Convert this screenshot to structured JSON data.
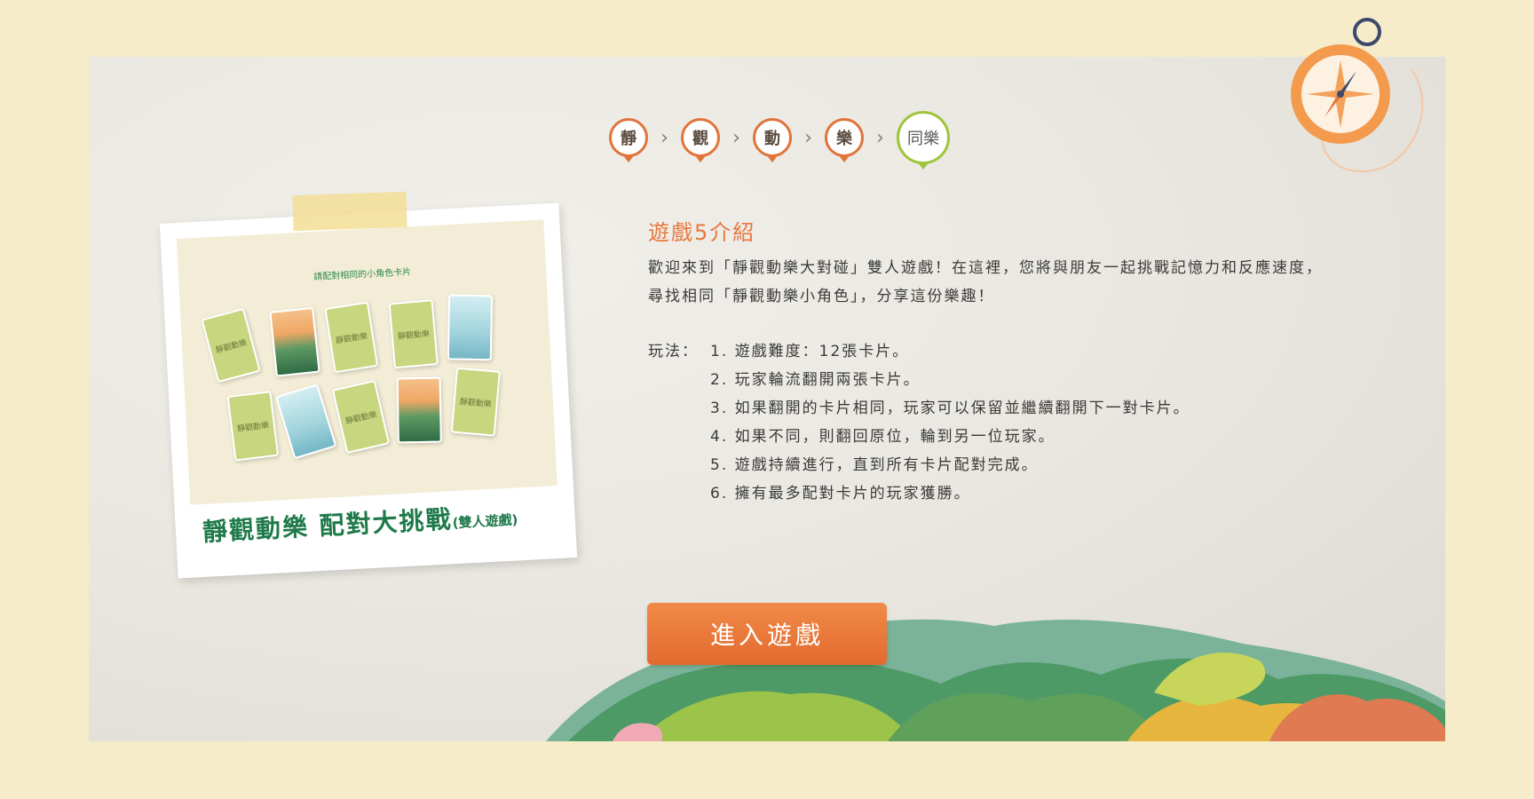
{
  "steps": [
    {
      "label": "靜",
      "active": false
    },
    {
      "label": "觀",
      "active": false
    },
    {
      "label": "動",
      "active": false
    },
    {
      "label": "樂",
      "active": false
    },
    {
      "label": "同樂",
      "active": true
    }
  ],
  "chevron": "›",
  "polaroid": {
    "photo_caption": "請配對相同的小角色卡片",
    "card_back_text": "靜觀動樂",
    "title": "靜觀動樂 配對大挑戰",
    "subtitle": "(雙人遊戲)"
  },
  "intro": {
    "title": "遊戲5介紹",
    "body": "歡迎來到「靜觀動樂大對碰」雙人遊戲！在這裡，您將與朋友一起挑戰記憶力和反應速度，尋找相同「靜觀動樂小角色」，分享這份樂趣！",
    "rules_label": "玩法：",
    "rules": [
      "1. 遊戲難度：12張卡片。",
      "2. 玩家輪流翻開兩張卡片。",
      "3. 如果翻開的卡片相同，玩家可以保留並繼續翻開下一對卡片。",
      "4. 如果不同，則翻回原位，輪到另一位玩家。",
      "5. 遊戲持續進行，直到所有卡片配對完成。",
      "6. 擁有最多配對卡片的玩家獲勝。"
    ]
  },
  "button": {
    "label": "進入遊戲"
  },
  "colors": {
    "background": "#f7ecc9",
    "accent_orange": "#e9773d",
    "active_green": "#9fc43c",
    "title_green": "#1f7a4a"
  },
  "icons": [
    "compass-icon"
  ]
}
